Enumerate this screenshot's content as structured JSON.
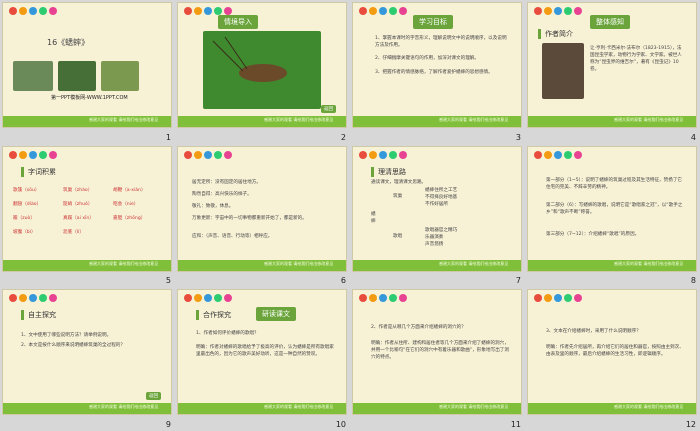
{
  "slides": [
    {
      "num": "1",
      "title": "16《蟋蟀》",
      "footer": "第一PPT模板网-WWW.1PPT.COM"
    },
    {
      "num": "2",
      "tag": "情境导入",
      "back": "返回"
    },
    {
      "num": "3",
      "tag": "学习目标",
      "lines": [
        "1、掌握本课时的字音形义，理解说明文中的说明顺序，以及说明方法及作用。",
        "2、仔细揣摩关键语句的作用，加深对课文的理解。",
        "3、把握作者的情感脉络，了解作者爱护蟋蟀的思想感情。"
      ]
    },
    {
      "num": "4",
      "tag": "整体感知",
      "sub": "作者简介",
      "bio": "让·亨利·卡西米尔·法布尔（1823-1915），法国昆虫学家，动物行为学家、文学家。被世人称为“昆虫界的维吉尔”，著有《昆虫记》10卷。"
    },
    {
      "num": "5",
      "box": "字词积累",
      "words": [
        "歌篷（sōu）",
        "筑巢（zhào）",
        "胡鞭（a-xiàn）",
        "翻翅（diào）",
        "陡峭（zhuó）",
        "昭会（nie）",
        "瓣（zuò）",
        "真蹊（ai xīn）",
        "嘉胆（zhōng）",
        "坡腹（bì）",
        "沥底（lí）"
      ]
    },
    {
      "num": "6",
      "lines": [
        "居无定所：没有固定的居住地方。",
        "陶然自得：高兴快乐的样子。",
        "敬礼：致敬，休息。",
        "万象更新：宇宙中的一切事物都重新开始了，都是新的。",
        "应和：（声音、语音、行动等）相呼应。"
      ]
    },
    {
      "num": "7",
      "box": "理清思路",
      "intro": "通读课文，理清课文思路。",
      "left": "蟋蟀",
      "a": "筑巢",
      "b": "歌唱",
      "a_items": [
        "蟋蟀住所之工艺",
        "不得择良好地基",
        "不作好居所"
      ],
      "b_items": [
        "歌唱器官之精巧",
        "乐器演奏",
        "声音悠扬"
      ]
    },
    {
      "num": "8",
      "paras": [
        "第一部分（1~5）：说明了蟋蟀的筑巢过程及其生活特征，赞扬了它住宅的完美、不辞辛劳的精神。",
        "第二部分（6）：写蟋蟀的歌唱，说明它是“歌唱家之冠”，以“歌手之乡”和“歌声不断”称誉。",
        "第三部分（7~12）：介绍蟋蟀“歌唱”的原因。"
      ]
    },
    {
      "num": "9",
      "box": "自主探究",
      "lines": [
        "1、文中使用了哪些说明方法？请举例说明。",
        "2、本文是按什么顺序来说明蟋蟀筑巢的全过程的？"
      ],
      "back": "返回"
    },
    {
      "num": "10",
      "box": "合作探究",
      "tag": "研读课文",
      "q": "1、作者如何评价蟋蟀的歌唱？",
      "a": "明确：作者对蟋蟀的歌唱给予了极高的评价，认为蟋蟀是所有歌唱家里最出色的，因为它的歌声美好动听，这是一种自然的赞叹。"
    },
    {
      "num": "11",
      "q": "2、作者是从哪几个方面来介绍蟋蟀的洞穴的？",
      "a": "明确：作者从住所、建构和居住者等几个方面来介绍了蟋蟀的洞穴，并用一个比喻句“在它们的洞穴中有着乐器和歌曲”，形象地写出了洞穴的特点。"
    },
    {
      "num": "12",
      "q": "3、文本在介绍蟋蟀时，采用了什么说明顺序？",
      "a": "明确：作者先介绍居所，再介绍它们的居住和器官，按照由主到次、由表及里的顺序，最后介绍蟋蟀的生活习性，即逻辑顺序。"
    }
  ],
  "footer_text": "感谢大家的观看  请给我们给出修改意见",
  "colors": {
    "green": "#6aa43a",
    "bg": "#f7f1d6",
    "red": "#c33"
  }
}
